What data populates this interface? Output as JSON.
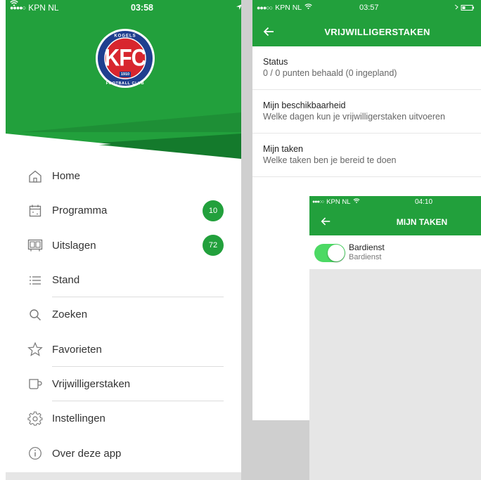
{
  "drawer": {
    "status": {
      "signal": "●●●●○",
      "carrier": "KPN NL",
      "time": "03:58"
    },
    "logo": {
      "letters": "KFC",
      "ring_text": "KOGELS · FOOTBALL CLUB",
      "year": "1910"
    },
    "menu": [
      {
        "label": "Home",
        "icon": "home-icon"
      },
      {
        "label": "Programma",
        "icon": "calendar-icon",
        "badge": "10"
      },
      {
        "label": "Uitslagen",
        "icon": "scoreboard-icon",
        "badge": "72"
      },
      {
        "label": "Stand",
        "icon": "list-icon"
      },
      {
        "label": "Zoeken",
        "icon": "search-icon"
      },
      {
        "label": "Favorieten",
        "icon": "star-icon"
      },
      {
        "label": "Vrijwilligerstaken",
        "icon": "cup-icon"
      },
      {
        "label": "Instellingen",
        "icon": "gear-icon"
      },
      {
        "label": "Over deze app",
        "icon": "info-icon"
      }
    ]
  },
  "volunteer": {
    "status": {
      "signal": "●●●○○",
      "carrier": "KPN NL",
      "time": "03:57"
    },
    "title": "VRIJWILLIGERSTAKEN",
    "rows": [
      {
        "title": "Status",
        "subtitle": "0 / 0 punten behaald (0 ingepland)"
      },
      {
        "title": "Mijn beschikbaarheid",
        "subtitle": "Welke dagen kun je vrijwilligerstaken uitvoeren"
      },
      {
        "title": "Mijn taken",
        "subtitle": "Welke taken ben je bereid te doen"
      }
    ]
  },
  "my_tasks": {
    "status": {
      "signal": "●●●○○",
      "carrier": "KPN NL",
      "time": "04:10"
    },
    "title": "MIJN TAKEN",
    "items": [
      {
        "title": "Bardienst",
        "subtitle": "Bardienst",
        "enabled": true
      }
    ]
  },
  "colors": {
    "brand_green": "#22a03c",
    "toggle_on": "#4cd964",
    "logo_blue": "#1f3f8f",
    "logo_red": "#d8262e"
  }
}
